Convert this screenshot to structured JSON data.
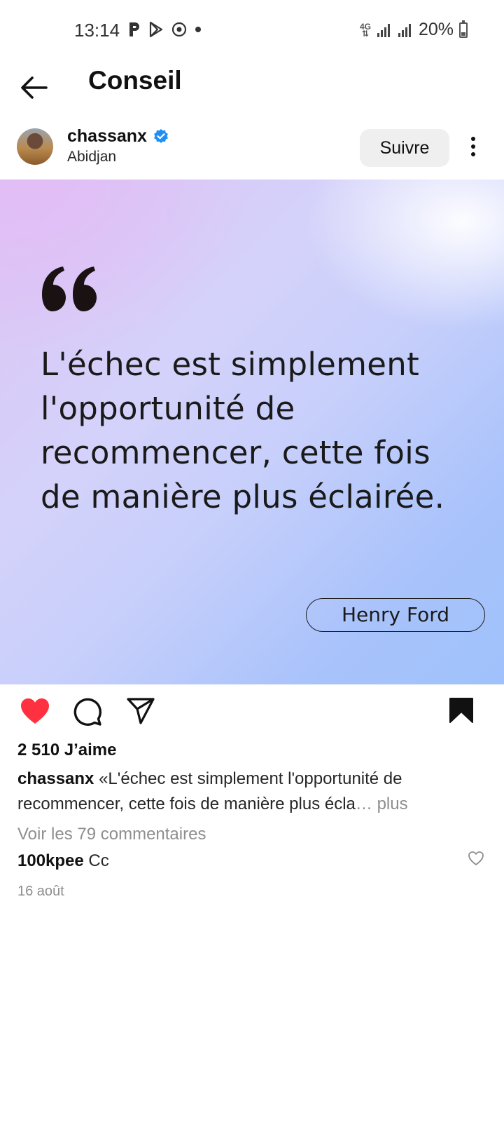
{
  "status_bar": {
    "time": "13:14",
    "app_icons": [
      "p-icon",
      "play-store-icon",
      "sync-icon",
      "dot-icon"
    ],
    "network_label_top": "4G",
    "battery": "20%"
  },
  "header": {
    "title": "Conseil"
  },
  "post": {
    "username": "chassanx",
    "location": "Abidjan",
    "follow_label": "Suivre",
    "quote": "L'échec est simplement l'opportunité de recommencer, cette fois de manière plus éclairée.",
    "author": "Henry Ford",
    "likes": "2 510 J’aime",
    "caption_user": "chassanx",
    "caption_text": "«L'échec est simplement l'opportunité de recommencer, cette fois de manière plus écla",
    "caption_more": "… plus",
    "view_comments": "Voir les 79 commentaires",
    "comment_user": "100kpee",
    "comment_text": "Cc",
    "date": "16 août"
  },
  "colors": {
    "like_red": "#ff3040",
    "verified_blue": "#1f8ff8",
    "follow_bg": "#efefef"
  }
}
